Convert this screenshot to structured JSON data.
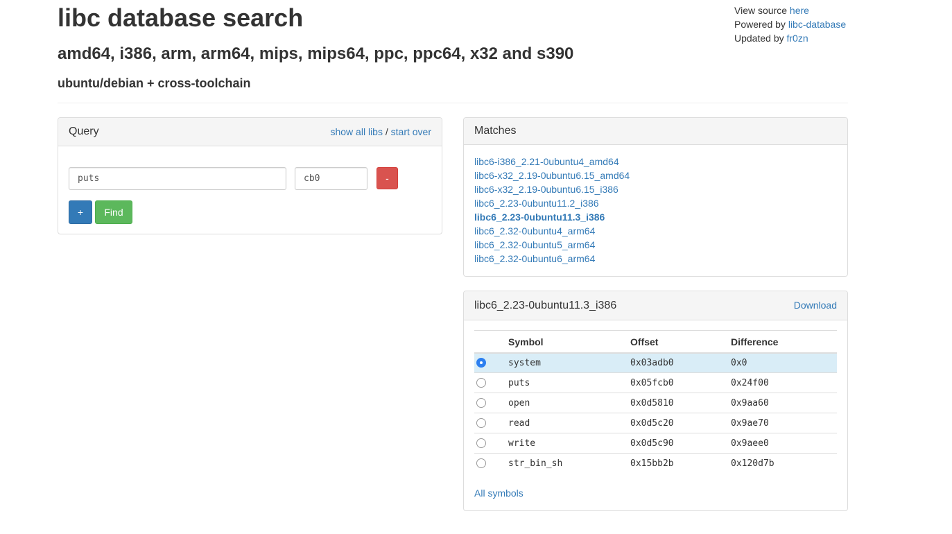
{
  "header": {
    "title": "libc database search",
    "arches": "amd64, i386, arm, arm64, mips, mips64, ppc, ppc64, x32 and s390",
    "sources": "ubuntu/debian + cross-toolchain"
  },
  "source_info": {
    "view_source_label": "View source ",
    "view_source_link": "here",
    "powered_by_label": "Powered by ",
    "powered_by_link": "libc-database",
    "updated_by_label": "Updated by ",
    "updated_by_link": "fr0zn"
  },
  "query": {
    "title": "Query",
    "show_all_libs": "show all libs",
    "separator": " / ",
    "start_over": "start over",
    "symbol_value": "puts",
    "address_value": "cb0",
    "remove_label": "-",
    "add_label": "+",
    "find_label": "Find"
  },
  "matches": {
    "title": "Matches",
    "items": [
      "libc6-i386_2.21-0ubuntu4_amd64",
      "libc6-x32_2.19-0ubuntu6.15_amd64",
      "libc6-x32_2.19-0ubuntu6.15_i386",
      "libc6_2.23-0ubuntu11.2_i386",
      "libc6_2.23-0ubuntu11.3_i386",
      "libc6_2.32-0ubuntu4_arm64",
      "libc6_2.32-0ubuntu5_arm64",
      "libc6_2.32-0ubuntu6_arm64"
    ],
    "active_index": 4
  },
  "result": {
    "title": "libc6_2.23-0ubuntu11.3_i386",
    "download_label": "Download",
    "columns": [
      "Symbol",
      "Offset",
      "Difference"
    ],
    "rows": [
      {
        "symbol": "system",
        "offset": "0x03adb0",
        "difference": "0x0",
        "selected": true
      },
      {
        "symbol": "puts",
        "offset": "0x05fcb0",
        "difference": "0x24f00",
        "selected": false
      },
      {
        "symbol": "open",
        "offset": "0x0d5810",
        "difference": "0x9aa60",
        "selected": false
      },
      {
        "symbol": "read",
        "offset": "0x0d5c20",
        "difference": "0x9ae70",
        "selected": false
      },
      {
        "symbol": "write",
        "offset": "0x0d5c90",
        "difference": "0x9aee0",
        "selected": false
      },
      {
        "symbol": "str_bin_sh",
        "offset": "0x15bb2b",
        "difference": "0x120d7b",
        "selected": false
      }
    ],
    "all_symbols_label": "All symbols"
  },
  "colors": {
    "link": "#337ab7",
    "danger": "#d9534f",
    "primary": "#337ab7",
    "success": "#5cb85c",
    "selected_row": "#d9edf7"
  }
}
